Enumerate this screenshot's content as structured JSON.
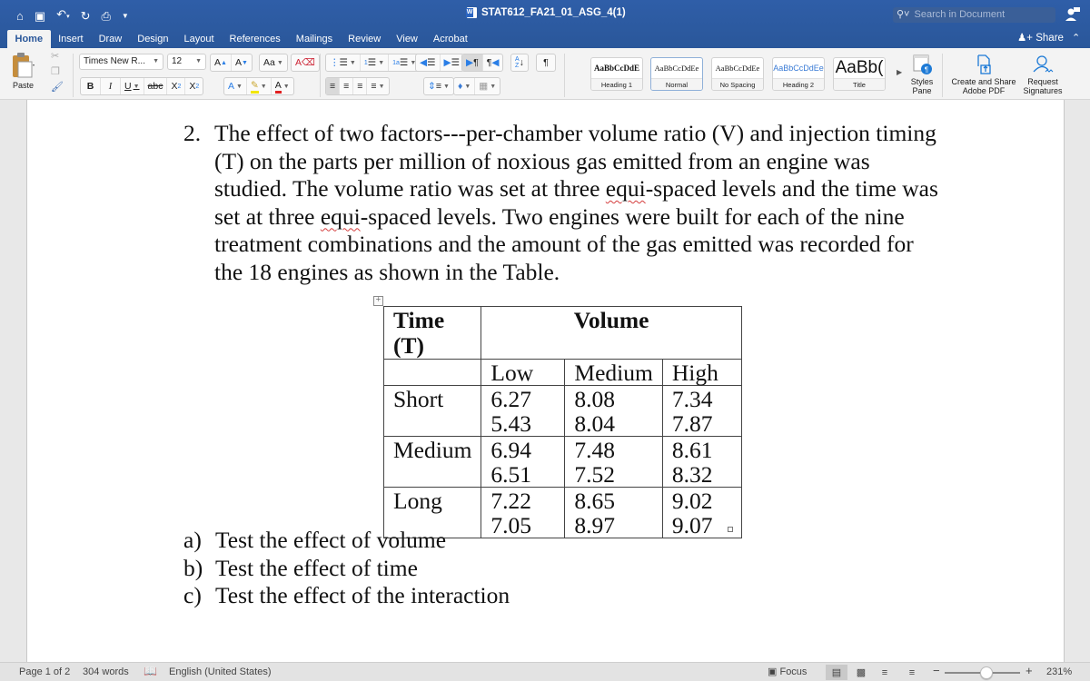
{
  "window": {
    "title": "STAT612_FA21_01_ASG_4(1)",
    "search_placeholder": "Search in Document"
  },
  "quick_access": [
    "home-icon",
    "save-icon",
    "undo-icon",
    "redo-icon",
    "print-icon",
    "customize-icon"
  ],
  "tabs": [
    {
      "label": "Home",
      "active": true
    },
    {
      "label": "Insert"
    },
    {
      "label": "Draw"
    },
    {
      "label": "Design"
    },
    {
      "label": "Layout"
    },
    {
      "label": "References"
    },
    {
      "label": "Mailings"
    },
    {
      "label": "Review"
    },
    {
      "label": "View"
    },
    {
      "label": "Acrobat"
    }
  ],
  "share_label": "Share",
  "ribbon": {
    "paste_label": "Paste",
    "font_name": "Times New R...",
    "font_size": "12",
    "styles": [
      {
        "sample": "AaBbCcDdE",
        "name": "Heading 1"
      },
      {
        "sample": "AaBbCcDdEe",
        "name": "Normal",
        "selected": true
      },
      {
        "sample": "AaBbCcDdEe",
        "name": "No Spacing"
      },
      {
        "sample": "AaBbCcDdEe",
        "name": "Heading 2"
      },
      {
        "sample": "AaBb(",
        "name": "Title"
      }
    ],
    "styles_pane": [
      "Styles",
      "Pane"
    ],
    "create_share_pdf": [
      "Create and Share",
      "Adobe PDF"
    ],
    "request_signatures": [
      "Request",
      "Signatures"
    ]
  },
  "document": {
    "question_number": "2.",
    "paragraph_lines": [
      "The effect of two factors---per-chamber volume ratio (V) and injection timing",
      "(T) on the parts per million of noxious gas emitted from an engine was",
      [
        "studied.  The volume ratio was set at three ",
        "equi",
        "-spaced levels and the time was"
      ],
      [
        "set at three ",
        "equi",
        "-spaced levels.  Two engines were built for each of the nine"
      ],
      "treatment combinations and the amount of the gas emitted was recorded for",
      "the 18 engines as shown in the Table."
    ],
    "table": {
      "header_time": [
        "Time",
        "(T)"
      ],
      "header_volume": "Volume",
      "volume_levels": [
        "Low",
        "Medium",
        "High"
      ],
      "rows": [
        {
          "time": "Short",
          "low": [
            "6.27",
            "5.43"
          ],
          "medium": [
            "8.08",
            "8.04"
          ],
          "high": [
            "7.34",
            "7.87"
          ]
        },
        {
          "time": "Medium",
          "low": [
            "6.94",
            "6.51"
          ],
          "medium": [
            "7.48",
            "7.52"
          ],
          "high": [
            "8.61",
            "8.32"
          ]
        },
        {
          "time": "Long",
          "low": [
            "7.22",
            "7.05"
          ],
          "medium": [
            "8.65",
            "8.97"
          ],
          "high": [
            "9.02",
            "9.07"
          ]
        }
      ]
    },
    "sub_questions": [
      {
        "label": "a)",
        "text": "Test the effect of volume"
      },
      {
        "label": "b)",
        "text": "Test the effect of time"
      },
      {
        "label": "c)",
        "text": "Test the effect of the interaction"
      }
    ]
  },
  "status_bar": {
    "page": "Page 1 of 2",
    "words": "304 words",
    "language": "English (United States)",
    "focus": "Focus",
    "zoom_level": "231%",
    "zoom_fraction": 0.55
  }
}
